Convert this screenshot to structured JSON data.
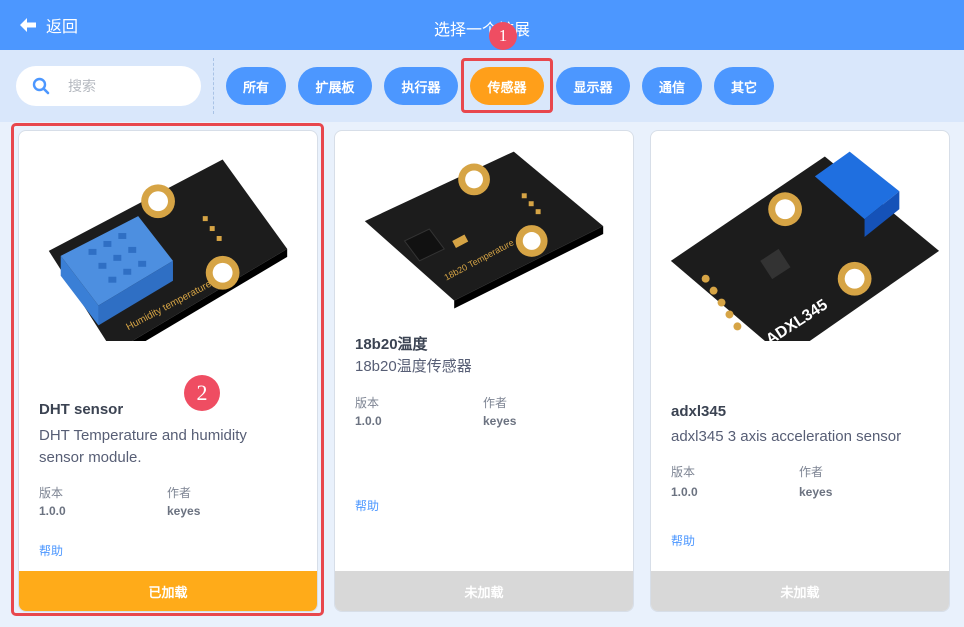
{
  "header": {
    "back_label": "返回",
    "title": "选择一个扩展"
  },
  "search": {
    "placeholder": "搜索"
  },
  "filters": [
    "所有",
    "扩展板",
    "执行器",
    "传感器",
    "显示器",
    "通信",
    "其它"
  ],
  "active_filter": "传感器",
  "annotations": [
    "1",
    "2"
  ],
  "cards": [
    {
      "name": "DHT sensor",
      "desc": "DHT Temperature and humidity sensor module.",
      "version_label": "版本",
      "version": "1.0.0",
      "author_label": "作者",
      "author": "keyes",
      "help": "帮助",
      "status": "已加载",
      "img_text": "Humidity temperature"
    },
    {
      "name": "18b20温度",
      "desc": "18b20温度传感器",
      "version_label": "版本",
      "version": "1.0.0",
      "author_label": "作者",
      "author": "keyes",
      "help": "帮助",
      "status": "未加载",
      "img_text": "18b20 Temperature"
    },
    {
      "name": "adxl345",
      "desc": "adxl345 3 axis acceleration sensor",
      "version_label": "版本",
      "version": "1.0.0",
      "author_label": "作者",
      "author": "keyes",
      "help": "帮助",
      "status": "未加载",
      "img_text": "ADXL345"
    }
  ],
  "colors": {
    "header": "#4c97ff",
    "active": "#ff9f1a",
    "loaded": "#ffab19",
    "unloaded": "#d8d8d8",
    "highlight": "#e8474d"
  }
}
